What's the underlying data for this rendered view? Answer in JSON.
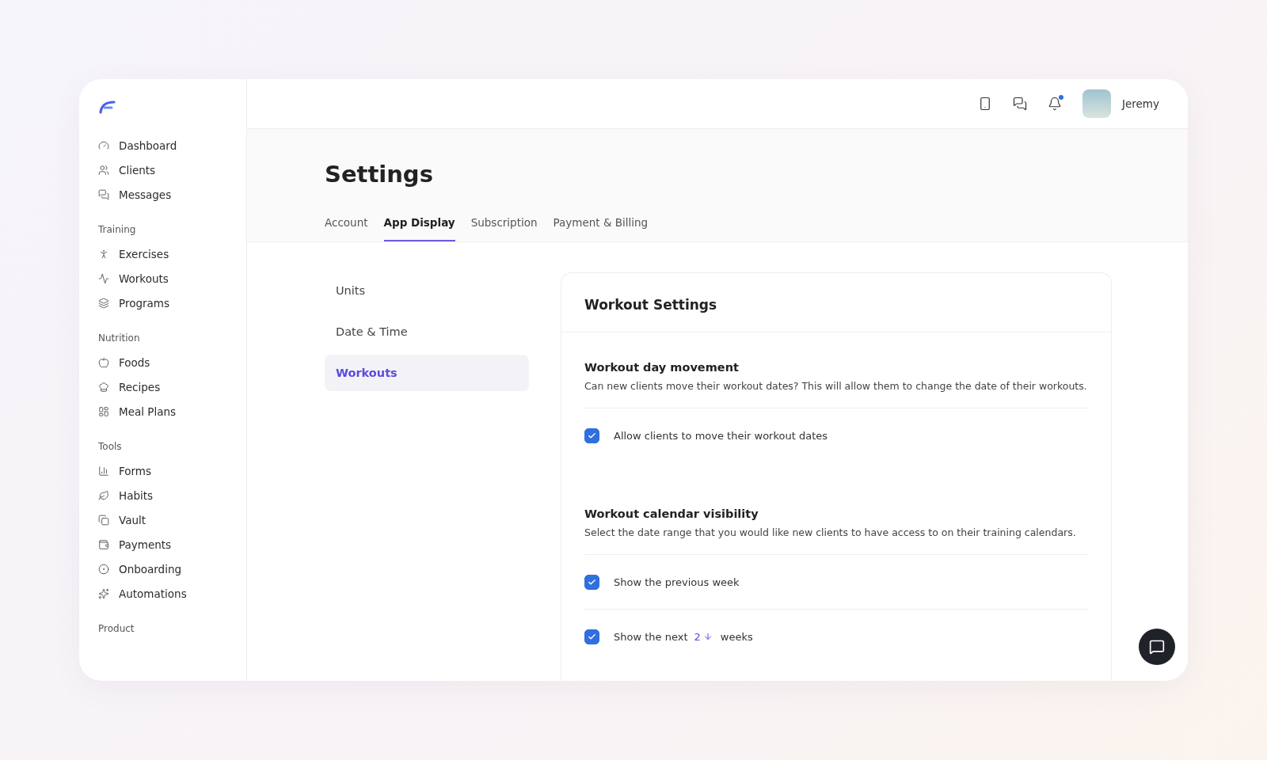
{
  "sidebar": {
    "sections": [
      {
        "items": [
          {
            "label": "Dashboard",
            "selected": false
          },
          {
            "label": "Clients",
            "selected": false
          },
          {
            "label": "Messages",
            "selected": false
          }
        ]
      },
      {
        "title": "Training",
        "items": [
          {
            "label": "Exercises",
            "selected": false
          },
          {
            "label": "Workouts",
            "selected": false
          },
          {
            "label": "Programs",
            "selected": false
          }
        ]
      },
      {
        "title": "Nutrition",
        "items": [
          {
            "label": "Foods",
            "selected": false
          },
          {
            "label": "Recipes",
            "selected": false
          },
          {
            "label": "Meal Plans",
            "selected": false
          }
        ]
      },
      {
        "title": "Tools",
        "items": [
          {
            "label": "Forms",
            "selected": false
          },
          {
            "label": "Habits",
            "selected": false
          },
          {
            "label": "Vault",
            "selected": false
          },
          {
            "label": "Payments",
            "selected": false
          },
          {
            "label": "Onboarding",
            "selected": false
          },
          {
            "label": "Automations",
            "selected": false
          }
        ]
      },
      {
        "title": "Product"
      }
    ]
  },
  "header": {
    "user": "Jeremy",
    "notification_dot": true
  },
  "page": {
    "title": "Settings",
    "tabs": [
      {
        "label": "Account",
        "selected": false
      },
      {
        "label": "App Display",
        "selected": true
      },
      {
        "label": "Subscription",
        "selected": false
      },
      {
        "label": "Payment & Billing",
        "selected": false
      }
    ]
  },
  "submenu": [
    {
      "label": "Units",
      "selected": false
    },
    {
      "label": "Date & Time",
      "selected": false
    },
    {
      "label": "Workouts",
      "selected": true
    }
  ],
  "panel": {
    "title": "Workout Settings",
    "groups": [
      {
        "title": "Workout day movement",
        "description": "Can new clients move their workout dates? This will allow them to change the date of their workouts.",
        "options": [
          {
            "kind": "checkbox",
            "label": "Allow clients to move their workout dates",
            "checked": true
          }
        ]
      },
      {
        "title": "Workout calendar visibility",
        "description": "Select the date range that you would like new clients to have access to on their training calendars.",
        "options": [
          {
            "kind": "checkbox",
            "label": "Show the previous week",
            "checked": true
          },
          {
            "kind": "stepper",
            "before": "Show the next",
            "value": "2",
            "after": "weeks",
            "checked": true
          }
        ]
      }
    ]
  }
}
